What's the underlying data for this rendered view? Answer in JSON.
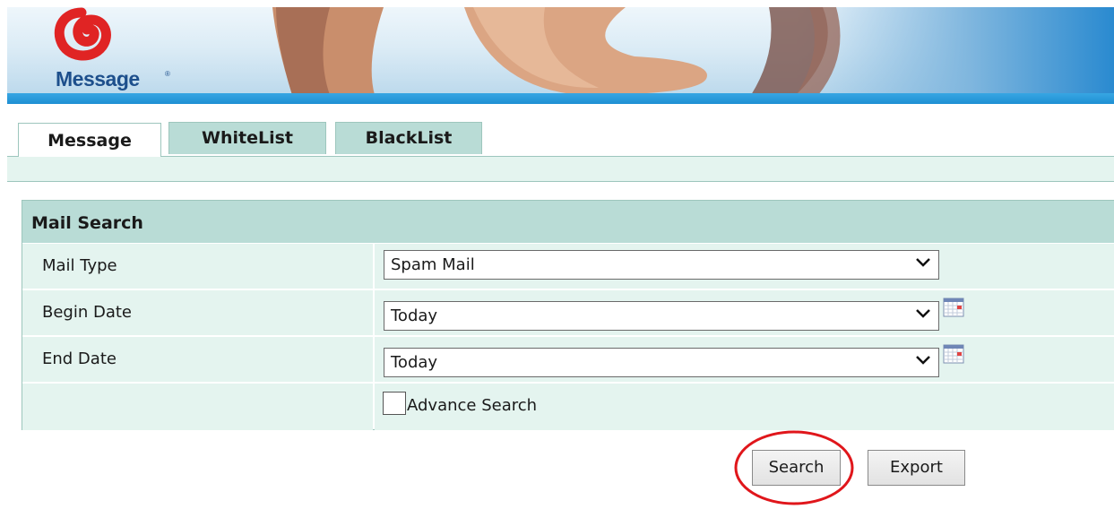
{
  "banner": {
    "logo_text": "Message",
    "logo_registered": "®"
  },
  "tabs": [
    {
      "label": "Message",
      "active": true
    },
    {
      "label": "WhiteList",
      "active": false
    },
    {
      "label": "BlackList",
      "active": false
    }
  ],
  "search_panel": {
    "title": "Mail Search",
    "fields": {
      "mail_type": {
        "label": "Mail Type",
        "value": "Spam Mail"
      },
      "begin_date": {
        "label": "Begin Date",
        "value": "Today"
      },
      "end_date": {
        "label": "End Date",
        "value": "Today"
      }
    },
    "advance_search": {
      "label": "Advance Search",
      "checked": false
    }
  },
  "buttons": {
    "search": "Search",
    "export": "Export"
  },
  "colors": {
    "header_bg": "#b9dcd6",
    "row_bg": "#e4f4ef",
    "border": "#9dc6bd",
    "banner_stripe": "#1e8fd3",
    "logo_red": "#e02424",
    "logo_blue": "#1d4f8c",
    "highlight": "#e0161b"
  },
  "icons": [
    "message-logo-icon",
    "chevron-down-icon",
    "calendar-icon",
    "checkbox"
  ]
}
